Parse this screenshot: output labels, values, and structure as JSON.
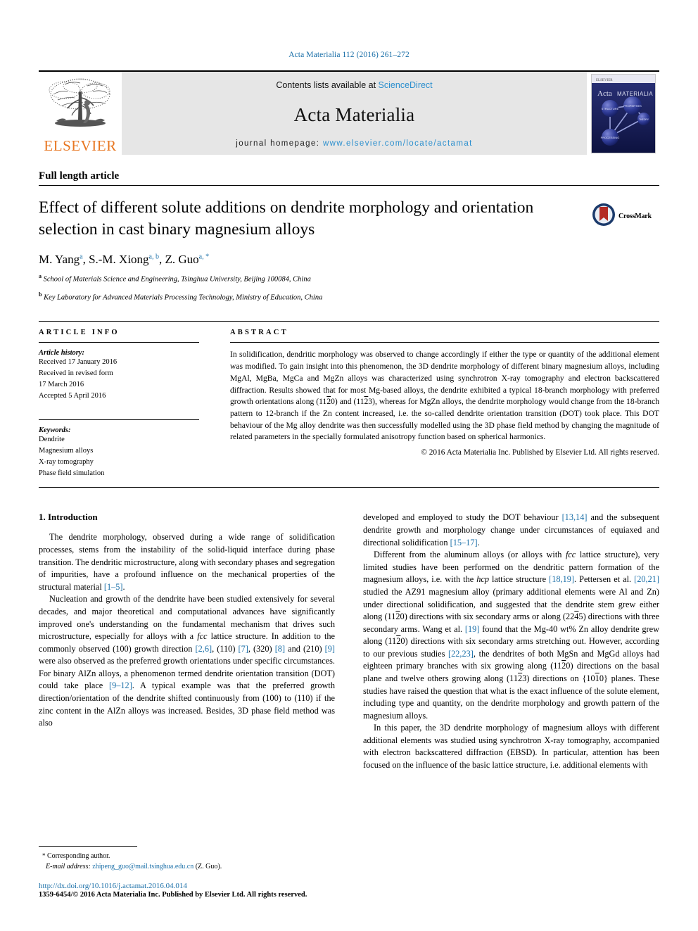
{
  "running_head": "Acta Materialia 112 (2016) 261–272",
  "masthead": {
    "contents_prefix": "Contents lists available at ",
    "sciencedirect": "ScienceDirect",
    "journal_title": "Acta Materialia",
    "homepage_prefix": "journal homepage: ",
    "homepage_url": "www.elsevier.com/locate/actamat",
    "publisher_wordmark": "ELSEVIER",
    "cover_title_a": "Acta",
    "cover_title_b": "MATERIALIA",
    "cover_nodes": [
      "STRUCTURE",
      "PROPERTIES",
      "THEORY",
      "PROCESSING"
    ]
  },
  "article": {
    "type": "Full length article",
    "title": "Effect of different solute additions on dendrite morphology and orientation selection in cast binary magnesium alloys",
    "authors_html": "M. Yang, S.-M. Xiong, Z. Guo",
    "authors": [
      {
        "name": "M. Yang",
        "marks": "a"
      },
      {
        "name": "S.-M. Xiong",
        "marks": "a, b"
      },
      {
        "name": "Z. Guo",
        "marks": "a, *"
      }
    ],
    "affiliations": [
      {
        "mark": "a",
        "text": "School of Materials Science and Engineering, Tsinghua University, Beijing 100084, China"
      },
      {
        "mark": "b",
        "text": "Key Laboratory for Advanced Materials Processing Technology, Ministry of Education, China"
      }
    ],
    "crossmark_label": "CrossMark"
  },
  "info": {
    "heading": "ARTICLE INFO",
    "history_label": "Article history:",
    "history": [
      "Received 17 January 2016",
      "Received in revised form",
      "17 March 2016",
      "Accepted 5 April 2016"
    ],
    "keywords_label": "Keywords:",
    "keywords": [
      "Dendrite",
      "Magnesium alloys",
      "X-ray tomography",
      "Phase field simulation"
    ]
  },
  "abstract": {
    "heading": "ABSTRACT",
    "paragraph_1": "In solidification, dendritic morphology was observed to change accordingly if either the type or quantity of the additional element was modified. To gain insight into this phenomenon, the 3D dendrite morphology of different binary magnesium alloys, including MgAl, MgBa, MgCa and MgZn alloys was characterized using synchrotron X-ray tomography and electron backscattered diffraction. Results showed that for most Mg-based alloys, the dendrite exhibited a typical 18-branch morphology with preferred growth orientations along (11",
    "mi_1": "2",
    "paragraph_2": "0) and (11",
    "mi_2": "2",
    "paragraph_3": "3), whereas for MgZn alloys, the dendrite morphology would change from the 18-branch pattern to 12-branch if the Zn content increased, i.e. the so-called dendrite orientation transition (DOT) took place. This DOT behaviour of the Mg alloy dendrite was then successfully modelled using the 3D phase field method by changing the magnitude of related parameters in the specially formulated anisotropy function based on spherical harmonics.",
    "copyright": "© 2016 Acta Materialia Inc. Published by Elsevier Ltd. All rights reserved."
  },
  "introduction": {
    "number_title": "1. Introduction",
    "left": {
      "p1_a": "The dendrite morphology, observed during a wide range of solidification processes, stems from the instability of the solid-liquid interface during phase transition. The dendritic microstructure, along with secondary phases and segregation of impurities, have a profound influence on the mechanical properties of the structural material ",
      "p1_ref": "[1–5]",
      "p1_b": ".",
      "p2_a": "Nucleation and growth of the dendrite have been studied extensively for several decades, and major theoretical and computational advances have significantly improved one's understanding on the fundamental mechanism that drives such microstructure, especially for alloys with a ",
      "p2_it": "fcc",
      "p2_b": " lattice structure. In addition to the commonly observed (100) growth direction ",
      "p2_ref1": "[2,6]",
      "p2_c": ", (110) ",
      "p2_ref2": "[7]",
      "p2_d": ", (320) ",
      "p2_ref3": "[8]",
      "p2_e": " and (210) ",
      "p2_ref4": "[9]",
      "p2_f": " were also observed as the preferred growth orientations under specific circumstances. For binary AlZn alloys, a phenomenon termed dendrite orientation transition (DOT) could take place ",
      "p2_ref5": "[9–12]",
      "p2_g": ". A typical example was that the preferred growth direction/orientation of the dendrite shifted continuously from (100) to (110) if the zinc content in the AlZn alloys was increased. Besides, 3D phase field method was also"
    },
    "right": {
      "p1_a": "developed and employed to study the DOT behaviour ",
      "p1_ref1": "[13,14]",
      "p1_b": " and the subsequent dendrite growth and morphology change under circumstances of equiaxed and directional solidification ",
      "p1_ref2": "[15–17]",
      "p1_c": ".",
      "p2_a": "Different from the aluminum alloys (or alloys with ",
      "p2_it1": "fcc",
      "p2_b": " lattice structure), very limited studies have been performed on the dendritic pattern formation of the magnesium alloys, i.e. with the ",
      "p2_it2": "hcp",
      "p2_c": " lattice structure ",
      "p2_ref1": "[18,19]",
      "p2_d": ". Pettersen et al. ",
      "p2_ref2": "[20,21]",
      "p2_e": " studied the AZ91 magnesium alloy (primary additional elements were Al and Zn) under directional solidification, and suggested that the dendrite stem grew either along (11",
      "p2_mi1": "2",
      "p2_f": "0) directions with six secondary arms or along (22",
      "p2_mi2": "4",
      "p2_g": "5) directions with three secondary arms. Wang et al. ",
      "p2_ref3": "[19]",
      "p2_h": " found that the Mg-40 wt% Zn alloy dendrite grew along (11",
      "p2_mi3": "2",
      "p2_i": "0) directions with six secondary arms stretching out. However, according to our previous studies ",
      "p2_ref4": "[22,23]",
      "p2_j": ", the dendrites of both MgSn and MgGd alloys had eighteen primary branches with six growing along (11",
      "p2_mi4": "2",
      "p2_k": "0) directions on the basal plane and twelve others growing along (11",
      "p2_mi5": "2",
      "p2_l": "3) directions on {10",
      "p2_mi6": "1",
      "p2_m": "0} planes. These studies have raised the question that what is the exact influence of the solute element, including type and quantity, on the dendrite morphology and growth pattern of the magnesium alloys.",
      "p3": "In this paper, the 3D dendrite morphology of magnesium alloys with different additional elements was studied using synchrotron X-ray tomography, accompanied with electron backscattered diffraction (EBSD). In particular, attention has been focused on the influence of the basic lattice structure, i.e. additional elements with"
    }
  },
  "footer": {
    "corresponding_star": "*",
    "corresponding_label": " Corresponding author.",
    "email_label": "E-mail address:",
    "email": "zhipeng_guo@mail.tsinghua.edu.cn",
    "email_suffix": " (Z. Guo).",
    "doi": "http://dx.doi.org/10.1016/j.actamat.2016.04.014",
    "issn_line": "1359-6454/© 2016 Acta Materialia Inc. Published by Elsevier Ltd. All rights reserved."
  },
  "colors": {
    "link": "#1a6fa8",
    "sciencedirect": "#2b8fce",
    "elsevier_orange": "#E87722",
    "band_gray": "#e6e6e6",
    "crossmark_red": "#b32b24",
    "cover_navy": "#1f2a6b"
  }
}
